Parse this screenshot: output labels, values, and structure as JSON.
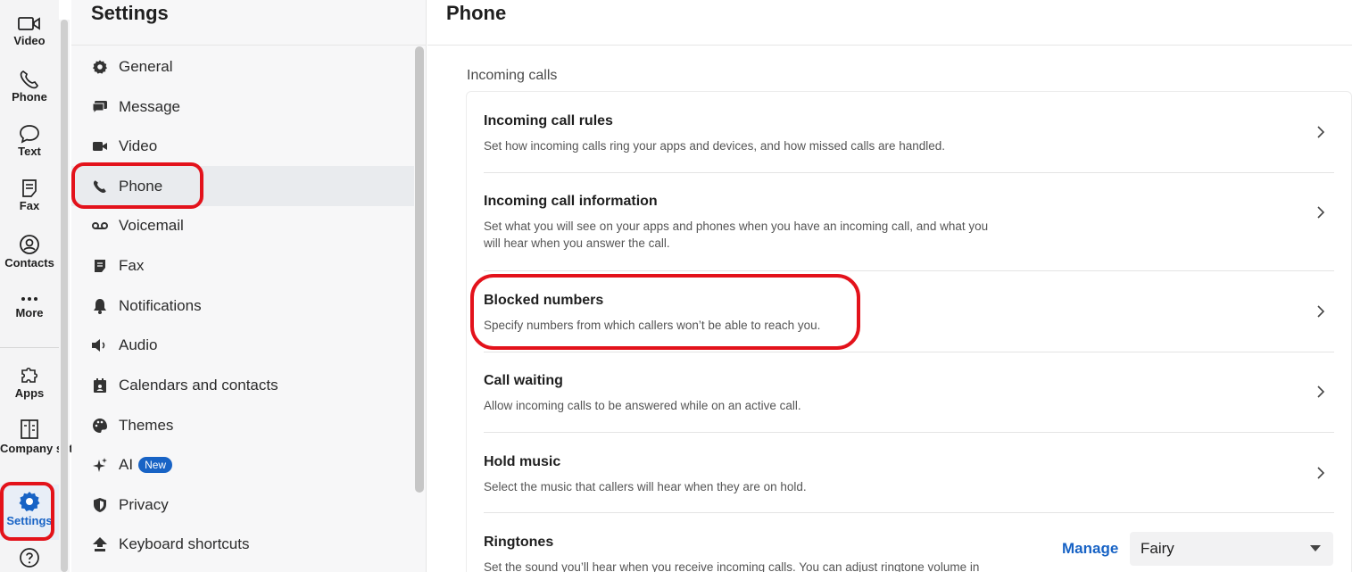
{
  "rail": {
    "items": [
      {
        "label": "Video",
        "icon": "video-icon"
      },
      {
        "label": "Phone",
        "icon": "phone-icon"
      },
      {
        "label": "Text",
        "icon": "chat-bubble-icon"
      },
      {
        "label": "Fax",
        "icon": "fax-icon"
      },
      {
        "label": "Contacts",
        "icon": "contacts-icon"
      },
      {
        "label": "More",
        "icon": "more-icon"
      },
      {
        "label": "Apps",
        "icon": "puzzle-icon"
      },
      {
        "label": "Company settings",
        "icon": "company-icon"
      },
      {
        "label": "Settings",
        "icon": "gear-icon"
      },
      {
        "label": "",
        "icon": "help-icon"
      }
    ]
  },
  "settings": {
    "title": "Settings",
    "items": [
      {
        "label": "General",
        "icon": "gear-icon"
      },
      {
        "label": "Message",
        "icon": "message-icon"
      },
      {
        "label": "Video",
        "icon": "video-camera-icon"
      },
      {
        "label": "Phone",
        "icon": "phone-icon",
        "active": true
      },
      {
        "label": "Voicemail",
        "icon": "voicemail-icon"
      },
      {
        "label": "Fax",
        "icon": "fax-icon"
      },
      {
        "label": "Notifications",
        "icon": "bell-icon"
      },
      {
        "label": "Audio",
        "icon": "speaker-icon"
      },
      {
        "label": "Calendars and contacts",
        "icon": "calendar-icon"
      },
      {
        "label": "Themes",
        "icon": "palette-icon"
      },
      {
        "label": "AI",
        "icon": "sparkle-icon",
        "badge": "New"
      },
      {
        "label": "Privacy",
        "icon": "shield-icon"
      },
      {
        "label": "Keyboard shortcuts",
        "icon": "keyboard-icon"
      }
    ]
  },
  "main": {
    "title": "Phone",
    "section_label": "Incoming calls",
    "rows": [
      {
        "title": "Incoming call rules",
        "desc": "Set how incoming calls ring your apps and devices, and how missed calls are handled."
      },
      {
        "title": "Incoming call information",
        "desc": "Set what you will see on your apps and phones when you have an incoming call, and what you",
        "desc2": "will hear when you answer the call."
      },
      {
        "title": "Blocked numbers",
        "desc": "Specify numbers from which callers won’t be able to reach you."
      },
      {
        "title": "Call waiting",
        "desc": "Allow incoming calls to be answered while on an active call."
      },
      {
        "title": "Hold music",
        "desc": "Select the music that callers will hear when they are on hold."
      },
      {
        "title": "Ringtones",
        "desc": "Set the sound you’ll hear when you receive incoming calls. You can adjust ringtone volume in"
      }
    ],
    "ringtone": {
      "manage_label": "Manage",
      "selected": "Fairy"
    }
  },
  "colors": {
    "accent": "#1863c5",
    "highlight": "#e3121b"
  }
}
